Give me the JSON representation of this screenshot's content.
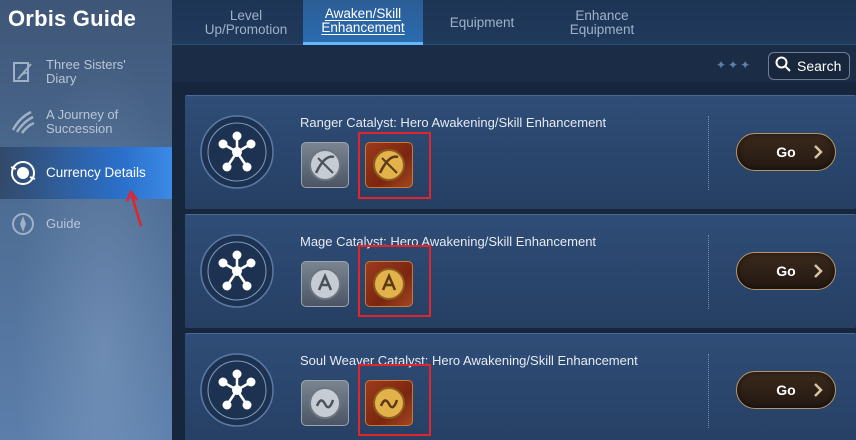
{
  "app": {
    "title": "Orbis Guide"
  },
  "sidebar": {
    "items": [
      {
        "label": "Three Sisters' Diary",
        "icon": "feather-book-icon",
        "active": false
      },
      {
        "label": "A Journey of Succession",
        "icon": "claw-icon",
        "active": false
      },
      {
        "label": "Currency Details",
        "icon": "currency-orb-icon",
        "active": true
      },
      {
        "label": "Guide",
        "icon": "compass-icon",
        "active": false
      }
    ]
  },
  "tabs": [
    {
      "label": "Level Up/Promotion",
      "active": false
    },
    {
      "label": "Awaken/Skill Enhancement",
      "active": true
    },
    {
      "label": "Equipment",
      "active": false
    },
    {
      "label": "Enhance Equipment",
      "active": false
    }
  ],
  "search": {
    "label": "Search",
    "dots": "✦✦✦"
  },
  "cards": [
    {
      "title": "Ranger Catalyst: Hero Awakening/Skill Enhancement",
      "button": "Go",
      "items": [
        "ranger-silver-catalyst-icon",
        "ranger-gold-catalyst-icon"
      ]
    },
    {
      "title": "Mage Catalyst: Hero Awakening/Skill Enhancement",
      "button": "Go",
      "items": [
        "mage-silver-catalyst-icon",
        "mage-gold-catalyst-icon"
      ]
    },
    {
      "title": "Soul Weaver Catalyst: Hero Awakening/Skill Enhancement",
      "button": "Go",
      "items": [
        "soulweaver-silver-catalyst-icon",
        "soulweaver-gold-catalyst-icon"
      ]
    }
  ],
  "colors": {
    "active_tab": "#2a6cb0",
    "active_nav": "#2a6fc9",
    "highlight": "#e3242b",
    "card": "#2f4d77"
  }
}
